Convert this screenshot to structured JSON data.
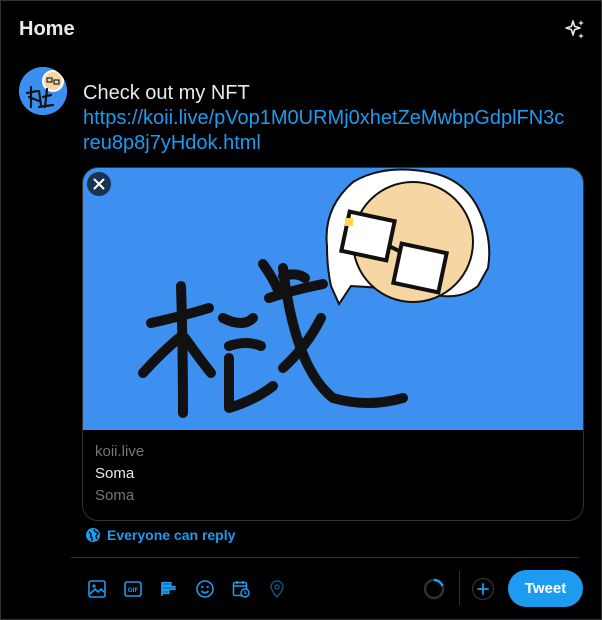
{
  "header": {
    "title": "Home",
    "sparkle_icon": "sparkle-icon"
  },
  "composer": {
    "text": "Check out my NFT",
    "link_line1": "https://koii.live/pVop1M0URMj0xhetZeMwbpGdplFN3c",
    "link_line2": "reu8p8j7yHdok.html"
  },
  "card": {
    "domain": "koii.live",
    "title": "Soma",
    "description": "Soma",
    "image_bg": "#3d8ff0"
  },
  "reply_setting": {
    "label": "Everyone can reply",
    "icon": "globe-icon"
  },
  "toolbar": {
    "icons": [
      "image-icon",
      "gif-icon",
      "poll-icon",
      "emoji-icon",
      "schedule-icon",
      "location-icon"
    ]
  },
  "actions": {
    "tweet_label": "Tweet",
    "add_icon": "plus-circle-icon"
  },
  "colors": {
    "accent": "#1d9bf0",
    "background": "#000000",
    "border": "#2f3336",
    "text_primary": "#e7e9ea",
    "text_secondary": "#71767b"
  }
}
